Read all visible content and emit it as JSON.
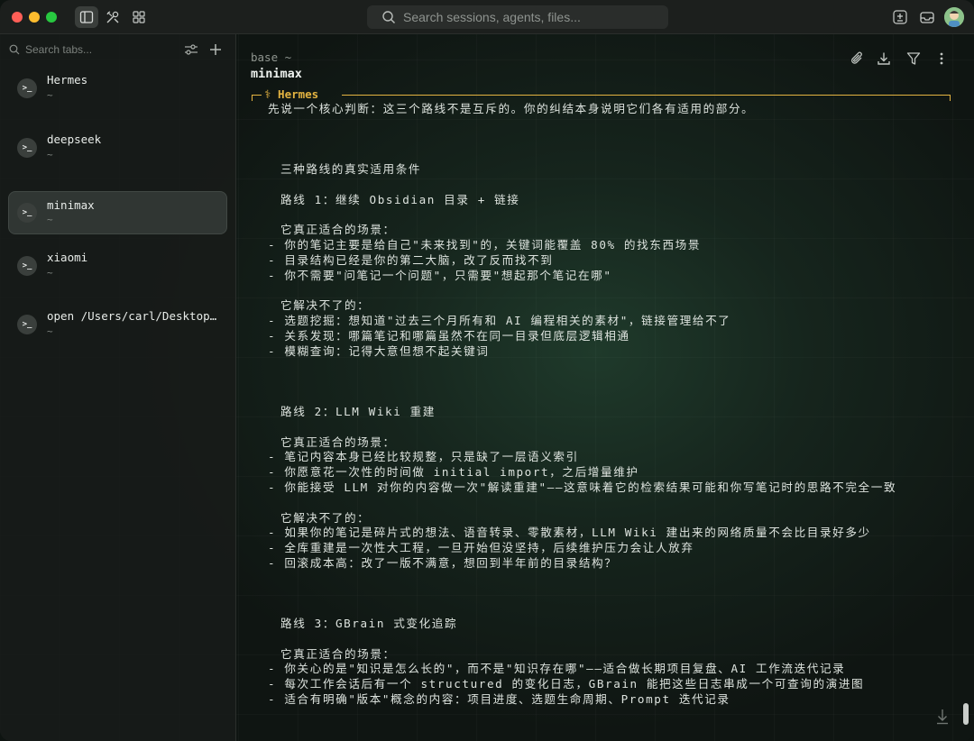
{
  "titlebar": {
    "search_placeholder": "Search sessions, agents, files..."
  },
  "sidebar": {
    "search_placeholder": "Search tabs...",
    "items": [
      {
        "title": "Hermes",
        "subtitle": "~",
        "icon": "terminal-icon",
        "active": false
      },
      {
        "title": "deepseek",
        "subtitle": "~",
        "icon": "terminal-icon",
        "active": false
      },
      {
        "title": "minimax",
        "subtitle": "~",
        "icon": "terminal-icon",
        "active": true
      },
      {
        "title": "xiaomi",
        "subtitle": "~",
        "icon": "terminal-icon",
        "active": false
      },
      {
        "title": "open /Users/carl/Desktop/AI/Obsidian",
        "subtitle": "~",
        "icon": "terminal-icon",
        "active": false
      }
    ]
  },
  "main": {
    "breadcrumb": "base ~",
    "title": "minimax",
    "panel_label": "⚕ Hermes",
    "lines": [
      "先说一个核心判断：这三个路线不是互斥的。你的纠结本身说明它们各有适用的部分。",
      "",
      "",
      "",
      "三种路线的真实适用条件",
      "",
      "路线 1：继续 Obsidian 目录 + 链接",
      "",
      "它真正适合的场景：",
      "- 你的笔记主要是给自己\"未来找到\"的，关键词能覆盖 80% 的找东西场景",
      "- 目录结构已经是你的第二大脑，改了反而找不到",
      "- 你不需要\"问笔记一个问题\"，只需要\"想起那个笔记在哪\"",
      "",
      "它解决不了的：",
      "- 选题挖掘：想知道\"过去三个月所有和 AI 编程相关的素材\"，链接管理给不了",
      "- 关系发现：哪篇笔记和哪篇虽然不在同一目录但底层逻辑相通",
      "- 模糊查询：记得大意但想不起关键词",
      "",
      "",
      "",
      "路线 2：LLM Wiki 重建",
      "",
      "它真正适合的场景：",
      "- 笔记内容本身已经比较规整，只是缺了一层语义索引",
      "- 你愿意花一次性的时间做 initial import，之后增量维护",
      "- 你能接受 LLM 对你的内容做一次\"解读重建\"——这意味着它的检索结果可能和你写笔记时的思路不完全一致",
      "",
      "它解决不了的：",
      "- 如果你的笔记是碎片式的想法、语音转录、零散素材，LLM Wiki 建出来的网络质量不会比目录好多少",
      "- 全库重建是一次性大工程，一旦开始但没坚持，后续维护压力会让人放弃",
      "- 回滚成本高：改了一版不满意，想回到半年前的目录结构？",
      "",
      "",
      "",
      "路线 3：GBrain 式变化追踪",
      "",
      "它真正适合的场景：",
      "- 你关心的是\"知识是怎么长的\"，而不是\"知识存在哪\"——适合做长期项目复盘、AI 工作流迭代记录",
      "- 每次工作会话后有一个 structured 的变化日志，GBrain 能把这些日志串成一个可查询的演进图",
      "- 适合有明确\"版本\"概念的内容：项目进度、选题生命周期、Prompt 迭代记录"
    ]
  },
  "colors": {
    "accent": "#e3b341",
    "background": "#0f1512",
    "sidebar": "#181b19"
  }
}
